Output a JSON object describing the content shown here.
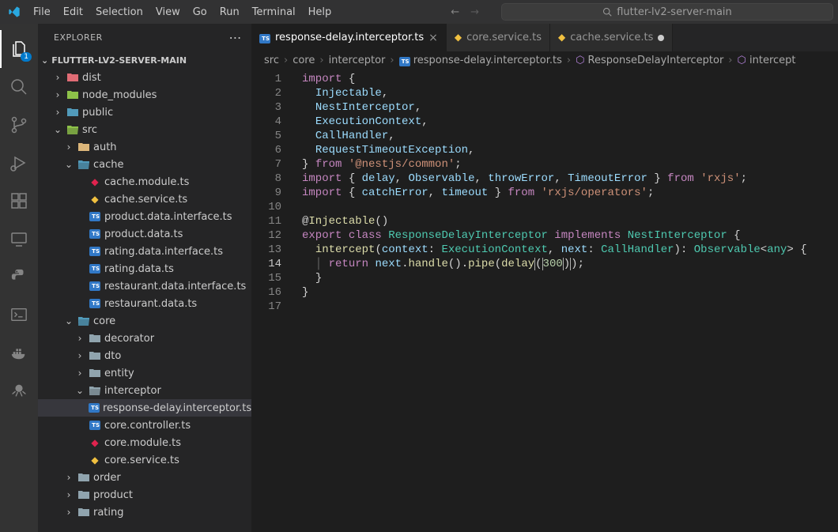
{
  "menu": [
    "File",
    "Edit",
    "Selection",
    "View",
    "Go",
    "Run",
    "Terminal",
    "Help"
  ],
  "search_text": "flutter-lv2-server-main",
  "activity_badge": "1",
  "sidebar": {
    "title": "EXPLORER",
    "section": "FLUTTER-LV2-SERVER-MAIN"
  },
  "tree": [
    {
      "d": 1,
      "t": "folder",
      "open": false,
      "label": "dist",
      "color": "#e06c75"
    },
    {
      "d": 1,
      "t": "folder",
      "open": false,
      "label": "node_modules",
      "color": "#8dc149"
    },
    {
      "d": 1,
      "t": "folder",
      "open": false,
      "label": "public",
      "color": "#519aba"
    },
    {
      "d": 1,
      "t": "folder",
      "open": true,
      "label": "src",
      "color": "#8dc149"
    },
    {
      "d": 2,
      "t": "folder",
      "open": false,
      "label": "auth",
      "color": "#dcb67a"
    },
    {
      "d": 2,
      "t": "folder",
      "open": true,
      "label": "cache",
      "color": "#519aba"
    },
    {
      "d": 3,
      "t": "file",
      "icon": "nest",
      "label": "cache.module.ts"
    },
    {
      "d": 3,
      "t": "file",
      "icon": "nest-y",
      "label": "cache.service.ts"
    },
    {
      "d": 3,
      "t": "file",
      "icon": "ts",
      "label": "product.data.interface.ts"
    },
    {
      "d": 3,
      "t": "file",
      "icon": "ts",
      "label": "product.data.ts"
    },
    {
      "d": 3,
      "t": "file",
      "icon": "ts",
      "label": "rating.data.interface.ts"
    },
    {
      "d": 3,
      "t": "file",
      "icon": "ts",
      "label": "rating.data.ts"
    },
    {
      "d": 3,
      "t": "file",
      "icon": "ts",
      "label": "restaurant.data.interface.ts"
    },
    {
      "d": 3,
      "t": "file",
      "icon": "ts",
      "label": "restaurant.data.ts"
    },
    {
      "d": 2,
      "t": "folder",
      "open": true,
      "label": "core",
      "color": "#519aba"
    },
    {
      "d": 3,
      "t": "folder",
      "open": false,
      "label": "decorator",
      "color": "#90a4ae"
    },
    {
      "d": 3,
      "t": "folder",
      "open": false,
      "label": "dto",
      "color": "#90a4ae"
    },
    {
      "d": 3,
      "t": "folder",
      "open": false,
      "label": "entity",
      "color": "#90a4ae"
    },
    {
      "d": 3,
      "t": "folder",
      "open": true,
      "label": "interceptor",
      "color": "#90a4ae"
    },
    {
      "d": 4,
      "t": "file",
      "icon": "ts",
      "label": "response-delay.interceptor.ts",
      "selected": true
    },
    {
      "d": 3,
      "t": "file",
      "icon": "ts",
      "label": "core.controller.ts"
    },
    {
      "d": 3,
      "t": "file",
      "icon": "nest",
      "label": "core.module.ts"
    },
    {
      "d": 3,
      "t": "file",
      "icon": "nest-y",
      "label": "core.service.ts"
    },
    {
      "d": 2,
      "t": "folder",
      "open": false,
      "label": "order",
      "color": "#90a4ae"
    },
    {
      "d": 2,
      "t": "folder",
      "open": false,
      "label": "product",
      "color": "#90a4ae"
    },
    {
      "d": 2,
      "t": "folder",
      "open": false,
      "label": "rating",
      "color": "#90a4ae"
    }
  ],
  "tabs": [
    {
      "icon": "ts",
      "label": "response-delay.interceptor.ts",
      "active": true,
      "close": "x"
    },
    {
      "icon": "nest-y",
      "label": "core.service.ts",
      "active": false,
      "close": ""
    },
    {
      "icon": "nest-y",
      "label": "cache.service.ts",
      "active": false,
      "close": "dot"
    }
  ],
  "breadcrumbs": [
    "src",
    "core",
    "interceptor",
    "response-delay.interceptor.ts",
    "ResponseDelayInterceptor",
    "intercept"
  ],
  "code": {
    "lines": 17,
    "current": 14,
    "content": [
      {
        "n": 1,
        "h": "<span class='kw'>import</span> <span class='pn'>{</span>"
      },
      {
        "n": 2,
        "h": "  <span class='id'>Injectable</span><span class='pn'>,</span>"
      },
      {
        "n": 3,
        "h": "  <span class='id'>NestInterceptor</span><span class='pn'>,</span>"
      },
      {
        "n": 4,
        "h": "  <span class='id'>ExecutionContext</span><span class='pn'>,</span>"
      },
      {
        "n": 5,
        "h": "  <span class='id'>CallHandler</span><span class='pn'>,</span>"
      },
      {
        "n": 6,
        "h": "  <span class='id'>RequestTimeoutException</span><span class='pn'>,</span>"
      },
      {
        "n": 7,
        "h": "<span class='pn'>}</span> <span class='kw'>from</span> <span class='str'>'@nestjs/common'</span><span class='pn'>;</span>"
      },
      {
        "n": 8,
        "h": "<span class='kw'>import</span> <span class='pn'>{</span> <span class='id'>delay</span><span class='pn'>,</span> <span class='id'>Observable</span><span class='pn'>,</span> <span class='id'>throwError</span><span class='pn'>,</span> <span class='id'>TimeoutError</span> <span class='pn'>}</span> <span class='kw'>from</span> <span class='str'>'rxjs'</span><span class='pn'>;</span>"
      },
      {
        "n": 9,
        "h": "<span class='kw'>import</span> <span class='pn'>{</span> <span class='id'>catchError</span><span class='pn'>,</span> <span class='id'>timeout</span> <span class='pn'>}</span> <span class='kw'>from</span> <span class='str'>'rxjs/operators'</span><span class='pn'>;</span>"
      },
      {
        "n": 10,
        "h": ""
      },
      {
        "n": 11,
        "h": "<span class='pn'>@</span><span class='fn'>Injectable</span><span class='pn'>()</span>"
      },
      {
        "n": 12,
        "h": "<span class='kw'>export</span> <span class='kw'>class</span> <span class='ty'>ResponseDelayInterceptor</span> <span class='kw'>implements</span> <span class='ty'>NestInterceptor</span> <span class='pn'>{</span>"
      },
      {
        "n": 13,
        "h": "  <span class='fn'>intercept</span><span class='pn'>(</span><span class='id'>context</span><span class='pn'>:</span> <span class='ty'>ExecutionContext</span><span class='pn'>,</span> <span class='id'>next</span><span class='pn'>:</span> <span class='ty'>CallHandler</span><span class='pn'>):</span> <span class='ty'>Observable</span><span class='pn'>&lt;</span><span class='ty'>any</span><span class='pn'>&gt; {</span>"
      },
      {
        "n": 14,
        "h": "  <span style='color:#6e6e6e'>│</span> <span class='kw'>return</span> <span class='id'>next</span><span class='pn'>.</span><span class='fn'>handle</span><span class='pn'>().</span><span class='fn'>pipe</span><span class='pn'>(</span><span class='fn'>delay</span><span class='pn curs'>(</span><span class='num'>300</span><span class='pn curs'>)</span><span class='pn'>);</span>"
      },
      {
        "n": 15,
        "h": "  <span class='pn'>}</span>"
      },
      {
        "n": 16,
        "h": "<span class='pn'>}</span>"
      },
      {
        "n": 17,
        "h": ""
      }
    ]
  }
}
